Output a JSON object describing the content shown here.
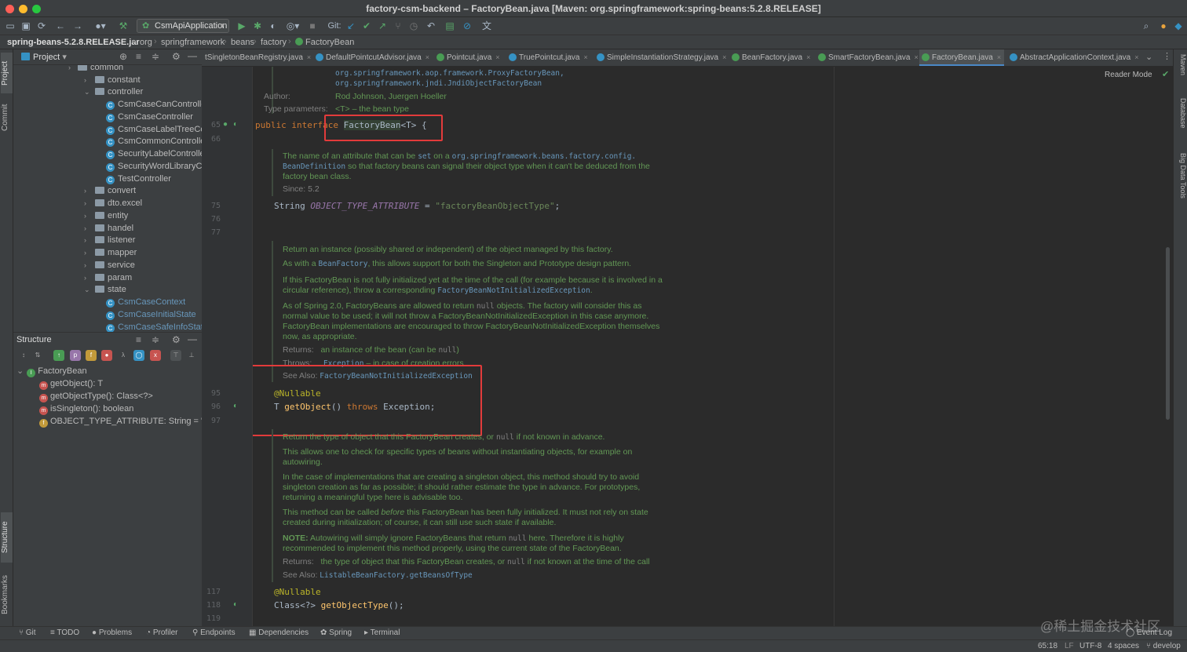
{
  "window": {
    "title": "factory-csm-backend – FactoryBean.java [Maven: org.springframework:spring-beans:5.2.8.RELEASE]"
  },
  "toolbar": {
    "run_config": "CsmApiApplication",
    "git_label": "Git:"
  },
  "breadcrumbs": [
    "spring-beans-5.2.8.RELEASE.jar",
    "org",
    "springframework",
    "beans",
    "factory",
    "FactoryBean"
  ],
  "left_stripe": {
    "project": "Project",
    "commit": "Commit",
    "structure": "Structure",
    "bookmarks": "Bookmarks"
  },
  "right_stripe": {
    "maven": "Maven",
    "database": "Database",
    "big_data": "Big Data Tools"
  },
  "project_panel": {
    "title": "Project",
    "tree": [
      {
        "label": "common",
        "kind": "folder",
        "expanded": false
      },
      {
        "label": "constant",
        "kind": "folder",
        "expanded": false
      },
      {
        "label": "controller",
        "kind": "folder",
        "expanded": true
      },
      {
        "label": "CsmCaseCanControlle",
        "kind": "class"
      },
      {
        "label": "CsmCaseController",
        "kind": "class"
      },
      {
        "label": "CsmCaseLabelTreeCo",
        "kind": "class"
      },
      {
        "label": "CsmCommonControlle",
        "kind": "class"
      },
      {
        "label": "SecurityLabelControlle",
        "kind": "class"
      },
      {
        "label": "SecurityWordLibraryC",
        "kind": "class"
      },
      {
        "label": "TestController",
        "kind": "class"
      },
      {
        "label": "convert",
        "kind": "folder",
        "expanded": false
      },
      {
        "label": "dto.excel",
        "kind": "folder",
        "expanded": false
      },
      {
        "label": "entity",
        "kind": "folder",
        "expanded": false
      },
      {
        "label": "handel",
        "kind": "folder",
        "expanded": false
      },
      {
        "label": "listener",
        "kind": "folder",
        "expanded": false
      },
      {
        "label": "mapper",
        "kind": "folder",
        "expanded": false
      },
      {
        "label": "service",
        "kind": "folder",
        "expanded": false
      },
      {
        "label": "param",
        "kind": "folder",
        "expanded": false
      },
      {
        "label": "state",
        "kind": "folder",
        "expanded": true
      },
      {
        "label": "CsmCaseContext",
        "kind": "class-blue"
      },
      {
        "label": "CsmCaseInitialState",
        "kind": "class-blue"
      },
      {
        "label": "CsmCaseSafeInfoState",
        "kind": "class-blue"
      }
    ]
  },
  "structure_panel": {
    "title": "Structure",
    "root": "FactoryBean",
    "members": [
      {
        "label": "getObject(): T",
        "badge": "m"
      },
      {
        "label": "getObjectType(): Class<?>",
        "badge": "m"
      },
      {
        "label": "isSingleton(): boolean",
        "badge": "m"
      },
      {
        "label": "OBJECT_TYPE_ATTRIBUTE: String = \"",
        "badge": "f"
      }
    ]
  },
  "editor_tabs": [
    {
      "label": "tSingletonBeanRegistry.java",
      "icon": "c",
      "active": false
    },
    {
      "label": "DefaultPointcutAdvisor.java",
      "icon": "c",
      "active": false
    },
    {
      "label": "Pointcut.java",
      "icon": "i",
      "active": false
    },
    {
      "label": "TruePointcut.java",
      "icon": "c",
      "active": false
    },
    {
      "label": "SimpleInstantiationStrategy.java",
      "icon": "c",
      "active": false
    },
    {
      "label": "BeanFactory.java",
      "icon": "i",
      "active": false
    },
    {
      "label": "SmartFactoryBean.java",
      "icon": "i",
      "active": false
    },
    {
      "label": "FactoryBean.java",
      "icon": "i",
      "active": true
    },
    {
      "label": "AbstractApplicationContext.java",
      "icon": "c",
      "active": false
    }
  ],
  "editor": {
    "reader_mode": "Reader Mode",
    "line_numbers": [
      "65",
      "66",
      "75",
      "76",
      "77",
      "95",
      "96",
      "97",
      "117",
      "118",
      "119"
    ],
    "see_refs": [
      "org.springframework.aop.framework.ProxyFactoryBean,",
      "org.springframework.jndi.JndiObjectFactoryBean"
    ],
    "author_label": "Author:",
    "author_value": "Rod Johnson, Juergen Hoeller",
    "typeparams_label": "Type parameters:",
    "typeparams_value": "<T> – the bean type",
    "line65": {
      "kw1": "public",
      "kw2": "interface",
      "name": "FactoryBean",
      "tparam": "<T>",
      "rest": " {"
    },
    "doc1": {
      "t1": "The name of an attribute that can be ",
      "c1": "set",
      "t2": " on a ",
      "c2": "org.springframework.beans.factory.config.",
      "c3": "BeanDefinition",
      "t3": " so that factory beans can signal their object type when it can't be deduced from the factory bean class.",
      "since": "Since: 5.2"
    },
    "line75": {
      "type": "String ",
      "const": "OBJECT_TYPE_ATTRIBUTE",
      "eq": " = ",
      "value": "\"factoryBeanObjectType\"",
      "semi": ";"
    },
    "doc2": {
      "p1": "Return an instance (possibly shared or independent) of the object managed by this factory.",
      "p2a": "As with a ",
      "p2c": "BeanFactory",
      "p2b": ", this allows support for both the Singleton and Prototype design pattern.",
      "p3a": "If this FactoryBean is not fully initialized yet at the time of the call (for example because it is involved in a circular reference), throw a corresponding ",
      "p3c": "FactoryBeanNotInitializedException",
      "p3b": ".",
      "p4a": "As of Spring 2.0, FactoryBeans are allowed to return ",
      "p4c": "null",
      "p4b": " objects. The factory will consider this as normal value to be used; it will not throw a FactoryBeanNotInitializedException in this case anymore. FactoryBean implementations are encouraged to throw FactoryBeanNotInitializedException themselves now, as appropriate.",
      "returns_label": "Returns:",
      "returns_text": "an instance of the bean (can be ",
      "returns_null": "null",
      "returns_end": ")",
      "throws_label": "Throws:",
      "throws_c": "Exception",
      "throws_text": " – in case of creation errors",
      "seealso_label": "See Also:",
      "seealso_c": "FactoryBeanNotInitializedException"
    },
    "line95": "@Nullable",
    "line96": {
      "t": "T ",
      "method": "getObject",
      "args": "() ",
      "kw": "throws",
      "rest": " Exception;"
    },
    "doc3": {
      "p1a": "Return the type of object that this FactoryBean creates, or ",
      "p1c": "null",
      "p1b": " if not known in advance.",
      "p2": "This allows one to check for specific types of beans without instantiating objects, for example on autowiring.",
      "p3": "In the case of implementations that are creating a singleton object, this method should try to avoid singleton creation as far as possible; it should rather estimate the type in advance. For prototypes, returning a meaningful type here is advisable too.",
      "p4a": "This method can be called ",
      "p4i": "before",
      "p4b": " this FactoryBean has been fully initialized. It must not rely on state created during initialization; of course, it can still use such state if available.",
      "p5n": "NOTE:",
      "p5a": " Autowiring will simply ignore FactoryBeans that return ",
      "p5c": "null",
      "p5b": " here. Therefore it is highly recommended to implement this method properly, using the current state of the FactoryBean.",
      "returns_label": "Returns:",
      "returns_a": "the type of object that this FactoryBean creates, or ",
      "returns_c": "null",
      "returns_b": " if not known at the time of the call",
      "seealso_label": "See Also:",
      "seealso_c": "ListableBeanFactory.getBeansOfType"
    },
    "line117": "@Nullable",
    "line118": {
      "pre": "Class<?> ",
      "method": "getObjectType",
      "rest": "();"
    }
  },
  "tool_windows": [
    "Git",
    "TODO",
    "Problems",
    "Profiler",
    "Endpoints",
    "Dependencies",
    "Spring",
    "Terminal"
  ],
  "event_log": "Event Log",
  "status": {
    "position": "65:18",
    "line_sep": "LF",
    "encoding": "UTF-8",
    "indent": "4 spaces",
    "branch": "develop"
  },
  "watermark": "@稀土掘金技术社区"
}
